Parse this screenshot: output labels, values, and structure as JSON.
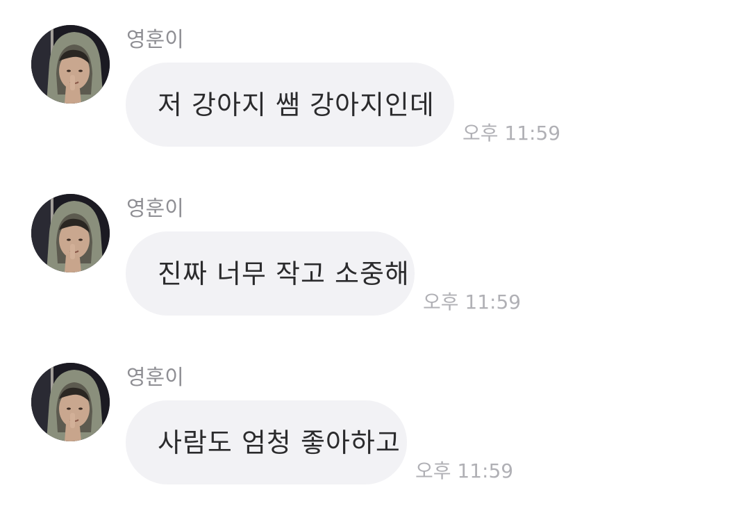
{
  "messages": [
    {
      "sender": "영훈이",
      "text": "저 강아지 쌤 강아지인데",
      "time": "오후 11:59",
      "avatar_icon": "profile-photo-hooded-person"
    },
    {
      "sender": "영훈이",
      "text": "진짜 너무 작고 소중해",
      "time": "오후 11:59",
      "avatar_icon": "profile-photo-hooded-person"
    },
    {
      "sender": "영훈이",
      "text": "사람도 엄청 좋아하고",
      "time": "오후 11:59",
      "avatar_icon": "profile-photo-hooded-person"
    }
  ],
  "colors": {
    "background": "#ffffff",
    "bubble": "#f2f2f5",
    "sender_text": "#8e8e93",
    "message_text": "#2b2b2d",
    "time_text": "#b0b0b5"
  }
}
